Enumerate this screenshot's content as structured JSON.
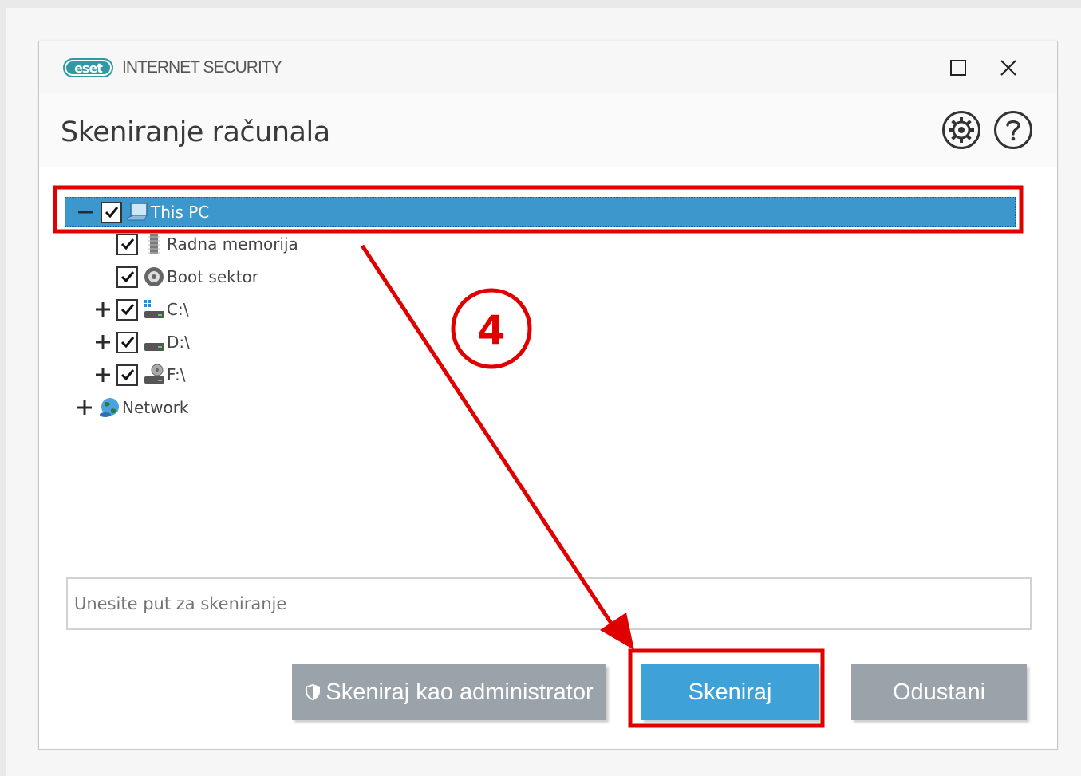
{
  "app": {
    "logo_badge": "eset",
    "product_name": "INTERNET SECURITY"
  },
  "header": {
    "title": "Skeniranje računala"
  },
  "tree": {
    "root": {
      "label": "This PC",
      "expanded": true,
      "checked": true,
      "icon": "computer-icon"
    },
    "items": [
      {
        "label": "Radna memorija",
        "checked": true,
        "expandable": false,
        "icon": "memory-icon"
      },
      {
        "label": "Boot sektor",
        "checked": true,
        "expandable": false,
        "icon": "disc-icon"
      },
      {
        "label": "C:\\",
        "checked": true,
        "expandable": true,
        "icon": "windows-drive-icon"
      },
      {
        "label": "D:\\",
        "checked": true,
        "expandable": true,
        "icon": "drive-icon"
      },
      {
        "label": "F:\\",
        "checked": true,
        "expandable": true,
        "icon": "optical-drive-icon"
      }
    ],
    "network": {
      "label": "Network",
      "expandable": true,
      "icon": "network-globe-icon"
    }
  },
  "path_input": {
    "placeholder": "Unesite put za skeniranje"
  },
  "buttons": {
    "admin": "Skeniraj kao administrator",
    "scan": "Skeniraj",
    "cancel": "Odustani"
  },
  "annotation": {
    "step_number": "4",
    "color": "#e00000"
  },
  "colors": {
    "selection": "#3c97cd",
    "primary_button": "#3ea2d9",
    "secondary_button": "#9aa3aa"
  }
}
